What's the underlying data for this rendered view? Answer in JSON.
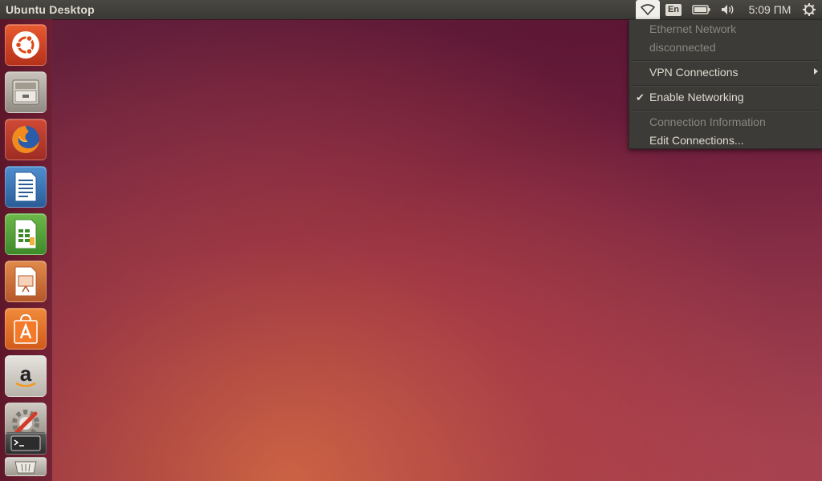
{
  "panel": {
    "title": "Ubuntu Desktop",
    "language": "En",
    "clock": "5:09 ПМ"
  },
  "network_menu": {
    "ethernet_title": "Ethernet Network",
    "ethernet_status": "disconnected",
    "vpn_connections": "VPN Connections",
    "enable_networking": "Enable Networking",
    "enable_networking_checked": true,
    "connection_information": "Connection Information",
    "edit_connections": "Edit Connections..."
  },
  "launcher": {
    "items": [
      {
        "name": "dash-home",
        "icon": "ubuntu-logo-icon"
      },
      {
        "name": "files",
        "icon": "file-cabinet-icon"
      },
      {
        "name": "firefox",
        "icon": "firefox-icon"
      },
      {
        "name": "libreoffice-writer",
        "icon": "writer-icon"
      },
      {
        "name": "libreoffice-calc",
        "icon": "calc-icon"
      },
      {
        "name": "libreoffice-impress",
        "icon": "impress-icon"
      },
      {
        "name": "software-center",
        "icon": "shopping-bag-icon"
      },
      {
        "name": "amazon",
        "icon": "amazon-icon"
      },
      {
        "name": "system-settings",
        "icon": "settings-tools-icon"
      },
      {
        "name": "terminal",
        "icon": "terminal-icon"
      },
      {
        "name": "trash",
        "icon": "trash-icon"
      }
    ]
  },
  "colors": {
    "panel_bg": "#3c3b37",
    "panel_text": "#dfdbd2",
    "menu_bg": "#3c3b37",
    "desktop_accent": "#dd4814"
  }
}
